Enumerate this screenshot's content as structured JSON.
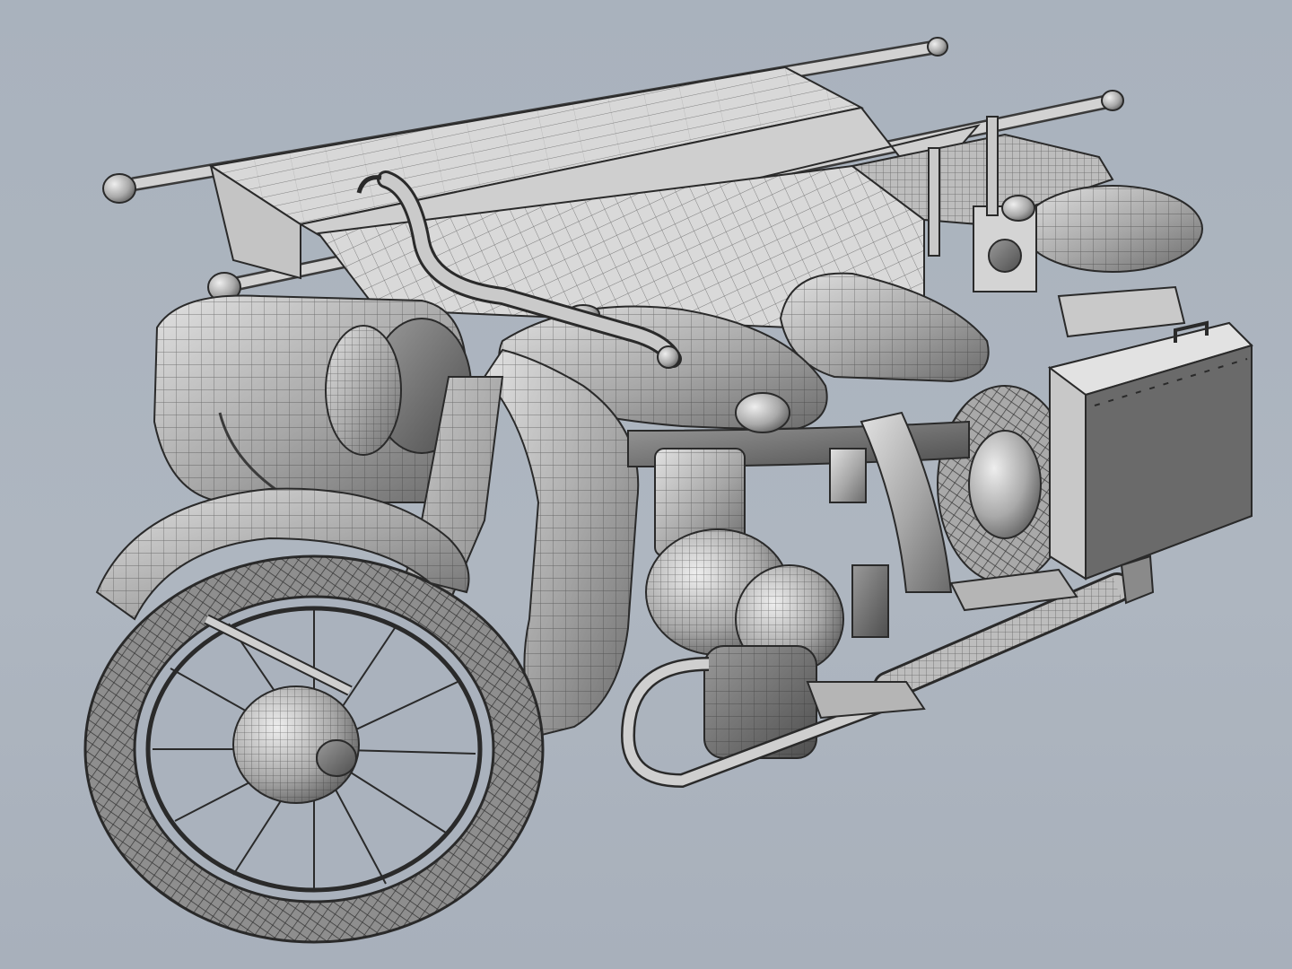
{
  "scene": {
    "subject": "motorcycle-with-sidecar-and-stretcher",
    "render_style": "wireframe-shaded",
    "colors": {
      "background": "#aab2bd",
      "surface_light": "#d9d9d9",
      "surface_mid": "#9c9c9c",
      "surface_dark": "#5a5a5a",
      "wire": "#2a2a2a"
    }
  }
}
